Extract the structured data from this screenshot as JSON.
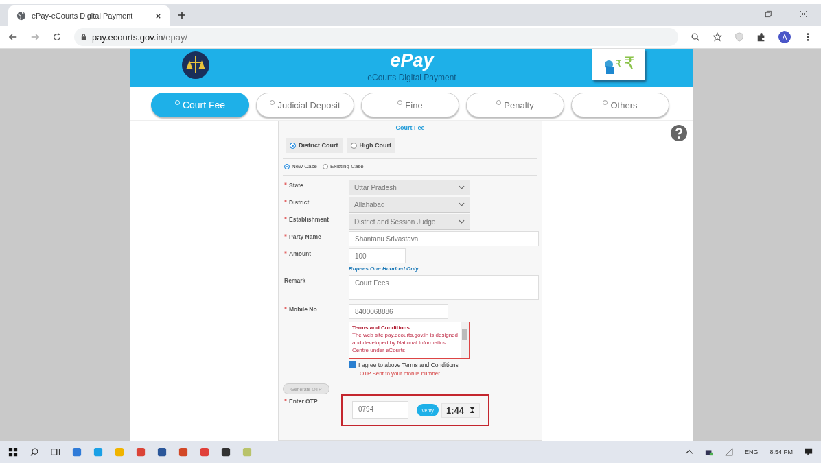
{
  "browser": {
    "tab_title": "ePay-eCourts Digital Payment",
    "url_host": "pay.ecourts.gov.in",
    "url_path": "/epay/",
    "profile_initial": "A"
  },
  "header": {
    "title": "ePay",
    "subtitle": "eCourts Digital Payment",
    "logo_symbols": [
      "₹",
      "₹"
    ]
  },
  "payment_tabs": [
    {
      "label": "Court Fee",
      "selected": true
    },
    {
      "label": "Judicial Deposit",
      "selected": false
    },
    {
      "label": "Fine",
      "selected": false
    },
    {
      "label": "Penalty",
      "selected": false
    },
    {
      "label": "Others",
      "selected": false
    }
  ],
  "form": {
    "title": "Court Fee",
    "court_options": [
      {
        "label": "District Court",
        "selected": true
      },
      {
        "label": "High Court",
        "selected": false
      }
    ],
    "case_options": [
      {
        "label": "New Case",
        "selected": true
      },
      {
        "label": "Existing Case",
        "selected": false
      }
    ],
    "fields": [
      {
        "kind": "select",
        "label": "State",
        "required": true,
        "value": "Uttar Pradesh"
      },
      {
        "kind": "select",
        "label": "District",
        "required": true,
        "value": "Allahabad"
      },
      {
        "kind": "select",
        "label": "Establishment",
        "required": true,
        "value": "District and Session Judge"
      },
      {
        "kind": "text",
        "label": "Party Name",
        "required": true,
        "value": "Shantanu Srivastava"
      },
      {
        "kind": "short",
        "label": "Amount",
        "required": true,
        "value": "100"
      },
      {
        "kind": "note",
        "value": "Rupees One Hundred Only"
      },
      {
        "kind": "area",
        "label": "Remark",
        "required": false,
        "value": "Court Fees"
      },
      {
        "kind": "medium",
        "label": "Mobile No",
        "required": true,
        "value": "8400068886"
      }
    ],
    "terms": {
      "title": "Terms and Conditions",
      "text": "The web site pay.ecourts.gov.in is designed and developed by National Informatics Centre under eCourts"
    },
    "agree": {
      "label": "I agree to above Terms and Conditions",
      "checked": true
    },
    "otp_notice": "OTP Sent to your mobile number",
    "generate_button": "Generate OTP",
    "otp": {
      "label": "Enter OTP",
      "value": "0794",
      "verify_button": "Verify",
      "timer": "1:44"
    }
  },
  "taskbar": {
    "language": "ENG",
    "time": "8:54 PM"
  }
}
